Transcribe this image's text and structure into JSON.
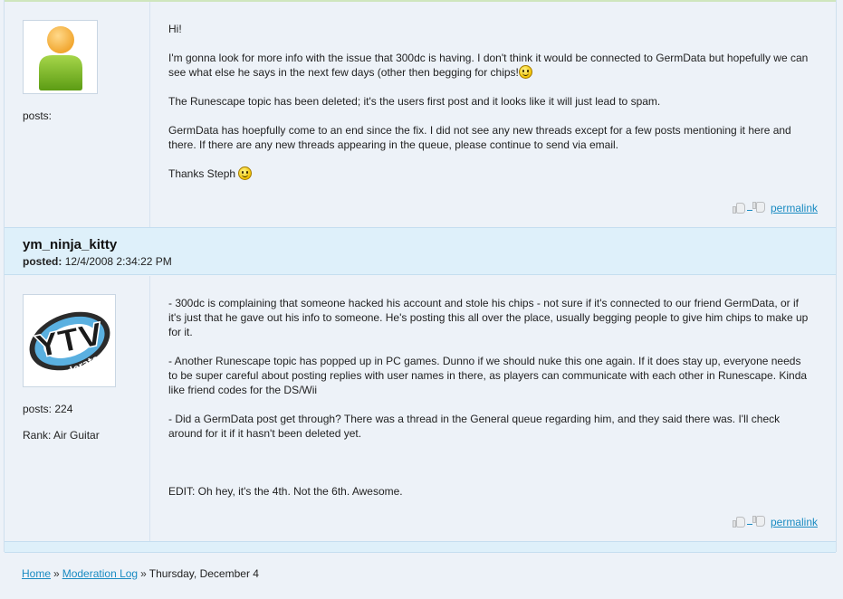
{
  "post1": {
    "posts_label": "posts:",
    "paragraphs": {
      "p1": "Hi!",
      "p2": "I'm gonna look for more info with the issue that 300dc is having. I don't think it would be connected to GermData but hopefully we can see what else he says in the next few days (other then begging for chips!",
      "p3": "The Runescape topic has been deleted; it's the users first post and it looks like it will just lead to spam.",
      "p4": "GermData has hoepfully come to an end since the fix. I did not see any new threads except for a few posts mentioning it here and there. If there are any new threads appearing in the queue, please continue to send via email.",
      "p5": "Thanks Steph"
    },
    "permalink": "permalink"
  },
  "post2": {
    "author": "ym_ninja_kitty",
    "posted_label": "posted:",
    "posted_value": "12/4/2008 2:34:22 PM",
    "posts_label": "posts: 224",
    "rank_label": "Rank: Air Guitar",
    "avatar_text": "YTV",
    "avatar_subtext": "moderator",
    "paragraphs": {
      "p1": "- 300dc is complaining that someone hacked his account and stole his chips - not sure if it's connected to our friend GermData, or if it's just that he gave out his info to someone. He's posting this all over the place, usually begging people to give him chips to make up for it.",
      "p2": "- Another Runescape topic has popped up in PC games. Dunno if we should nuke this one again. If it does stay up, everyone needs to be super careful about posting replies with user names in there, as players can communicate with each other in Runescape. Kinda like friend codes for the DS/Wii",
      "p3": "- Did a GermData post get through? There was a thread in the General queue regarding him, and they said there was. I'll check around for it if it hasn't been deleted yet.",
      "p4": "EDIT: Oh hey, it's the 4th. Not the 6th. Awesome."
    },
    "permalink": "permalink"
  },
  "breadcrumb": {
    "home": "Home",
    "sep": "»",
    "log": "Moderation Log",
    "current": "Thursday, December 4"
  },
  "colors": {
    "link": "#1a8bc2",
    "author_bar": "#def0fa",
    "page_bg": "#edf2f8"
  }
}
